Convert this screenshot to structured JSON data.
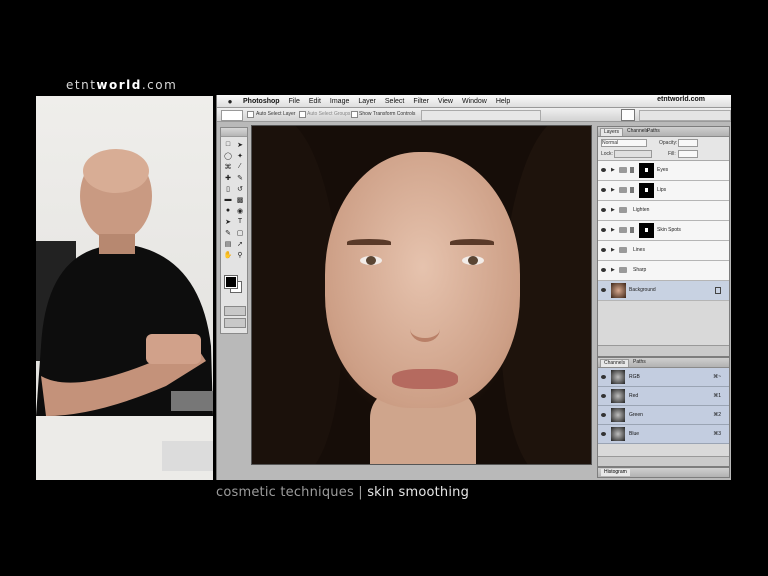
{
  "brand": {
    "prefix": "etnt",
    "bold": "world",
    "suffix": ".com"
  },
  "menubar": {
    "app_name": "Photoshop",
    "items": [
      "File",
      "Edit",
      "Image",
      "Layer",
      "Select",
      "Filter",
      "View",
      "Window",
      "Help"
    ],
    "site": "etntworld.com"
  },
  "options_bar": {
    "auto_select_layer": "Auto Select Layer",
    "auto_select_groups": "Auto Select Groups",
    "show_transform_controls": "Show Transform Controls"
  },
  "layers_panel": {
    "tabs": [
      "Layers",
      "Channels",
      "Paths"
    ],
    "blend_mode": "Normal",
    "opacity_label": "Opacity:",
    "lock_label": "Lock:",
    "fill_label": "Fill:",
    "layers": [
      {
        "name": "Eyes",
        "type": "group",
        "mask": true
      },
      {
        "name": "Lips",
        "type": "group",
        "mask": true
      },
      {
        "name": "Lighten",
        "type": "group",
        "mask": false
      },
      {
        "name": "Skin Spots",
        "type": "group",
        "mask": true
      },
      {
        "name": "Lines",
        "type": "group",
        "mask": false
      },
      {
        "name": "Sharp",
        "type": "group",
        "mask": false
      },
      {
        "name": "Background",
        "type": "image",
        "mask": false
      }
    ]
  },
  "channels_panel": {
    "tabs": [
      "Channels",
      "Paths"
    ],
    "channels": [
      {
        "name": "RGB",
        "shortcut": "⌘~"
      },
      {
        "name": "Red",
        "shortcut": "⌘1"
      },
      {
        "name": "Green",
        "shortcut": "⌘2"
      },
      {
        "name": "Blue",
        "shortcut": "⌘3"
      }
    ]
  },
  "histogram_tab": "Histogram",
  "caption": {
    "left": "cosmetic techniques",
    "sep": "|",
    "right": "skin smoothing"
  },
  "colors": {
    "accent_selection": "#c8d2e2",
    "background": "#000000"
  }
}
